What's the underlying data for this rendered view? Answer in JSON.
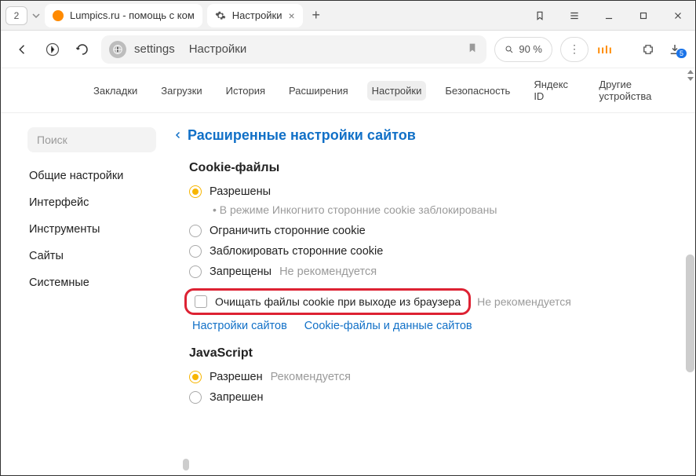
{
  "tabs": {
    "count": "2",
    "tab1_label": "Lumpics.ru - помощь с ком",
    "tab2_label": "Настройки"
  },
  "addr": {
    "host": "settings",
    "title": "Настройки",
    "zoom": "90 %",
    "dl_badge": "5"
  },
  "nav": {
    "bookmarks": "Закладки",
    "downloads": "Загрузки",
    "history": "История",
    "extensions": "Расширения",
    "settings": "Настройки",
    "security": "Безопасность",
    "yandex_id": "Яндекс ID",
    "other_devices": "Другие устройства"
  },
  "sidebar": {
    "search_ph": "Поиск",
    "general": "Общие настройки",
    "interface": "Интерфейс",
    "tools": "Инструменты",
    "sites": "Сайты",
    "system": "Системные"
  },
  "page": {
    "title": "Расширенные настройки сайтов",
    "cookies": {
      "heading": "Cookie-файлы",
      "allowed": "Разрешены",
      "incognito_note": "• В режиме Инкогнито сторонние cookie заблокированы",
      "limit": "Ограничить сторонние cookie",
      "block": "Заблокировать сторонние cookie",
      "deny": "Запрещены",
      "deny_hint": "Не рекомендуется",
      "clear_on_exit": "Очищать файлы cookie при выходе из браузера",
      "clear_hint": "Не рекомендуется",
      "sites_link": "Настройки сайтов",
      "data_link": "Cookie-файлы и данные сайтов"
    },
    "js": {
      "heading": "JavaScript",
      "allowed": "Разрешен",
      "allowed_hint": "Рекомендуется",
      "denied": "Запрешен"
    }
  }
}
